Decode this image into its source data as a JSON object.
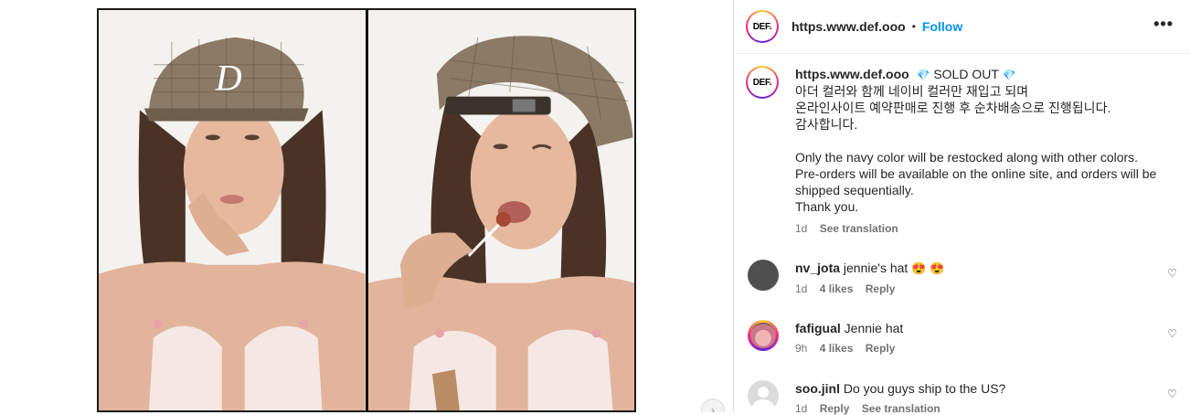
{
  "header": {
    "username": "https.www.def.ooo",
    "separator": "•",
    "follow_label": "Follow",
    "more_label": "•••",
    "avatar_text": "DEF."
  },
  "caption": {
    "username": "https.www.def.ooo",
    "gem": "💎",
    "status": "SOLD OUT",
    "lines": [
      "아더 컬러와 함께 네이비 컬러만 재입고 되며",
      "온라인사이트 예약판매로 진행 후 순차배송으로 진행됩니다.",
      "감사합니다.",
      "",
      "Only the navy color will be restocked along with other colors.",
      "Pre-orders will be available on the online site, and orders will be",
      "shipped sequentially.",
      "Thank you."
    ],
    "time": "1d",
    "see_translation": "See translation"
  },
  "comments": [
    {
      "username": "nv_jota",
      "text": "jennie's hat",
      "emoji": "😍 😍",
      "time": "1d",
      "likes": "4 likes",
      "reply": "Reply"
    },
    {
      "username": "fafigual",
      "text": "Jennie hat",
      "emoji": "",
      "time": "9h",
      "likes": "4 likes",
      "reply": "Reply"
    },
    {
      "username": "soo.jinl",
      "text": "Do you guys ship to the US?",
      "emoji": "",
      "time": "1d",
      "likes": "",
      "reply": "Reply",
      "see_translation": "See translation"
    }
  ],
  "icons": {
    "heart": "heart-icon",
    "next": "chevron-right-icon",
    "more": "more-options-icon"
  },
  "colors": {
    "follow": "#0095f6",
    "secondary_text": "#737373",
    "primary_text": "#262626"
  },
  "media": {
    "hat_logo_letter": "D"
  }
}
